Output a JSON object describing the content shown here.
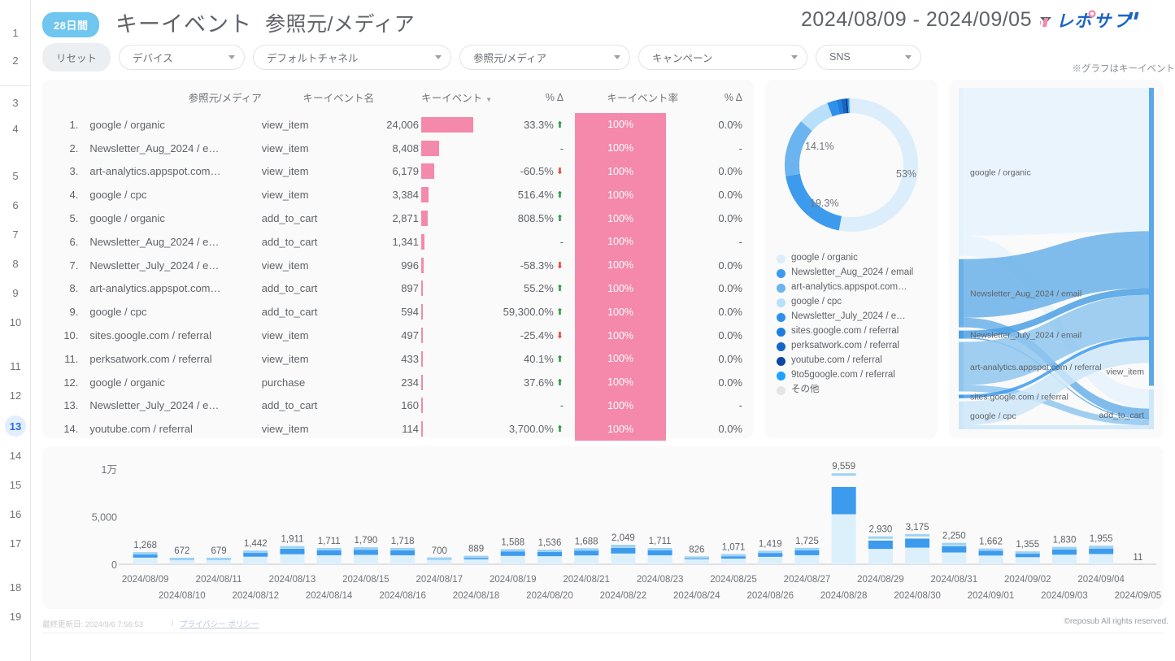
{
  "rail": {
    "pages": [
      "1",
      "2",
      "3",
      "4",
      "5",
      "6",
      "7",
      "8",
      "9",
      "10",
      "11",
      "12",
      "13",
      "14",
      "15",
      "16",
      "17",
      "18",
      "19"
    ],
    "active": "13",
    "next_icon": "chevron-right-icon"
  },
  "header": {
    "badge": "28日間",
    "title": "キーイベント",
    "subtitle": "参照元/メディア",
    "date_range": "2024/08/09 - 2024/09/05",
    "logo_text": "レポサブ",
    "note": "※グラフはキーイベント"
  },
  "filters": {
    "reset_label": "リセット",
    "pills": [
      {
        "label": "デバイス"
      },
      {
        "label": "デフォルトチャネル"
      },
      {
        "label": "参照元/メディア"
      },
      {
        "label": "キャンペーン"
      },
      {
        "label": "SNS"
      }
    ]
  },
  "table": {
    "headers": {
      "index": "",
      "source": "参照元/メディア",
      "event": "キーイベント名",
      "keyevent": "キーイベント",
      "delta1": "% Δ",
      "rate": "キーイベント率",
      "delta2": "% Δ"
    },
    "sort_column": "キーイベント",
    "rows": [
      {
        "index": "1.",
        "source": "google / organic",
        "event": "view_item",
        "value": "24,006",
        "value_num": 24006,
        "delta1": "33.3%",
        "dir1": "up",
        "rate": "100%",
        "delta2": "0.0%",
        "dir2": "none"
      },
      {
        "index": "2.",
        "source": "Newsletter_Aug_2024 / e…",
        "event": "view_item",
        "value": "8,408",
        "value_num": 8408,
        "delta1": "-",
        "dir1": "none",
        "rate": "100%",
        "delta2": "-",
        "dir2": "none"
      },
      {
        "index": "3.",
        "source": "art-analytics.appspot.com…",
        "event": "view_item",
        "value": "6,179",
        "value_num": 6179,
        "delta1": "-60.5%",
        "dir1": "down",
        "rate": "100%",
        "delta2": "0.0%",
        "dir2": "none"
      },
      {
        "index": "4.",
        "source": "google / cpc",
        "event": "view_item",
        "value": "3,384",
        "value_num": 3384,
        "delta1": "516.4%",
        "dir1": "up",
        "rate": "100%",
        "delta2": "0.0%",
        "dir2": "none"
      },
      {
        "index": "5.",
        "source": "google / organic",
        "event": "add_to_cart",
        "value": "2,871",
        "value_num": 2871,
        "delta1": "808.5%",
        "dir1": "up",
        "rate": "100%",
        "delta2": "0.0%",
        "dir2": "none"
      },
      {
        "index": "6.",
        "source": "Newsletter_Aug_2024 / e…",
        "event": "add_to_cart",
        "value": "1,341",
        "value_num": 1341,
        "delta1": "-",
        "dir1": "none",
        "rate": "100%",
        "delta2": "-",
        "dir2": "none"
      },
      {
        "index": "7.",
        "source": "Newsletter_July_2024 / e…",
        "event": "view_item",
        "value": "996",
        "value_num": 996,
        "delta1": "-58.3%",
        "dir1": "down",
        "rate": "100%",
        "delta2": "0.0%",
        "dir2": "none"
      },
      {
        "index": "8.",
        "source": "art-analytics.appspot.com…",
        "event": "add_to_cart",
        "value": "897",
        "value_num": 897,
        "delta1": "55.2%",
        "dir1": "up",
        "rate": "100%",
        "delta2": "0.0%",
        "dir2": "none"
      },
      {
        "index": "9.",
        "source": "google / cpc",
        "event": "add_to_cart",
        "value": "594",
        "value_num": 594,
        "delta1": "59,300.0%",
        "dir1": "up",
        "rate": "100%",
        "delta2": "0.0%",
        "dir2": "none"
      },
      {
        "index": "10.",
        "source": "sites.google.com / referral",
        "event": "view_item",
        "value": "497",
        "value_num": 497,
        "delta1": "-25.4%",
        "dir1": "down",
        "rate": "100%",
        "delta2": "0.0%",
        "dir2": "none"
      },
      {
        "index": "11.",
        "source": "perksatwork.com / referral",
        "event": "view_item",
        "value": "433",
        "value_num": 433,
        "delta1": "40.1%",
        "dir1": "up",
        "rate": "100%",
        "delta2": "0.0%",
        "dir2": "none"
      },
      {
        "index": "12.",
        "source": "google / organic",
        "event": "purchase",
        "value": "234",
        "value_num": 234,
        "delta1": "37.6%",
        "dir1": "up",
        "rate": "100%",
        "delta2": "0.0%",
        "dir2": "none"
      },
      {
        "index": "13.",
        "source": "Newsletter_July_2024 / e…",
        "event": "add_to_cart",
        "value": "160",
        "value_num": 160,
        "delta1": "-",
        "dir1": "none",
        "rate": "100%",
        "delta2": "-",
        "dir2": "none"
      },
      {
        "index": "14.",
        "source": "youtube.com / referral",
        "event": "view_item",
        "value": "114",
        "value_num": 114,
        "delta1": "3,700.0%",
        "dir1": "up",
        "rate": "100%",
        "delta2": "0.0%",
        "dir2": "none"
      }
    ]
  },
  "chart_data": [
    {
      "type": "pie",
      "name": "donut-source-share",
      "title": "",
      "labels_shown": [
        "53%",
        "19.3%",
        "14.1%"
      ],
      "legend_position": "bottom",
      "slices": [
        {
          "label": "google / organic",
          "value": 53.0,
          "color": "#dceefb",
          "shown_label": "53%"
        },
        {
          "label": "Newsletter_Aug_2024 / email",
          "value": 19.3,
          "color": "#3d9bee",
          "shown_label": "19.3%"
        },
        {
          "label": "art-analytics.appspot.com…",
          "value": 14.1,
          "color": "#6bb4f0",
          "shown_label": "14.1%"
        },
        {
          "label": "google / cpc",
          "value": 7.7,
          "color": "#b9e0fa",
          "shown_label": ""
        },
        {
          "label": "Newsletter_July_2024 / e…",
          "value": 2.3,
          "color": "#2f90ea",
          "shown_label": ""
        },
        {
          "label": "sites.google.com / referral",
          "value": 1.1,
          "color": "#1f7fe0",
          "shown_label": ""
        },
        {
          "label": "perksatwork.com / referral",
          "value": 1.0,
          "color": "#1765c4",
          "shown_label": ""
        },
        {
          "label": "youtube.com / referral",
          "value": 0.6,
          "color": "#0d47a1",
          "shown_label": ""
        },
        {
          "label": "9to5google.com / referral",
          "value": 0.4,
          "color": "#1fa2ff",
          "shown_label": ""
        },
        {
          "label": "その他",
          "value": 0.5,
          "color": "#e3e5e7",
          "shown_label": ""
        }
      ]
    },
    {
      "type": "bar",
      "name": "daily-key-events",
      "title": "",
      "xlabel": "",
      "ylabel": "",
      "ylim": [
        0,
        10000
      ],
      "ytick_labels": [
        "0",
        "5,000",
        "1万"
      ],
      "ytick_values": [
        0,
        5000,
        10000
      ],
      "grid": false,
      "categories": [
        "2024/08/09",
        "2024/08/10",
        "2024/08/11",
        "2024/08/12",
        "2024/08/13",
        "2024/08/14",
        "2024/08/15",
        "2024/08/16",
        "2024/08/17",
        "2024/08/18",
        "2024/08/19",
        "2024/08/20",
        "2024/08/21",
        "2024/08/22",
        "2024/08/23",
        "2024/08/24",
        "2024/08/25",
        "2024/08/26",
        "2024/08/27",
        "2024/08/28",
        "2024/08/29",
        "2024/08/30",
        "2024/08/31",
        "2024/09/01",
        "2024/09/02",
        "2024/09/03",
        "2024/09/04",
        "2024/09/05"
      ],
      "values": [
        1268,
        672,
        679,
        1442,
        1911,
        1711,
        1790,
        1718,
        700,
        889,
        1588,
        1536,
        1688,
        2049,
        1711,
        826,
        1071,
        1419,
        1725,
        9559,
        2930,
        3175,
        2250,
        1662,
        1355,
        1830,
        1955,
        11
      ],
      "value_labels": [
        "1,268",
        "672",
        "679",
        "1,442",
        "1,911",
        "1,711",
        "1,790",
        "1,718",
        "700",
        "889",
        "1,588",
        "1,536",
        "1,688",
        "2,049",
        "1,711",
        "826",
        "1,071",
        "1,419",
        "1,725",
        "9,559",
        "2,930",
        "3,175",
        "2,250",
        "1,662",
        "1,355",
        "1,830",
        "1,955",
        "11"
      ]
    },
    {
      "type": "sankey",
      "name": "source-to-event-flow",
      "nodes_left": [
        {
          "label": "google / organic",
          "value": 24006
        },
        {
          "label": "Newsletter_Aug_2024 / email",
          "value": 9749
        },
        {
          "label": "Newsletter_July_2024 / email",
          "value": 1156
        },
        {
          "label": "art-analytics.appspot.com / referral",
          "value": 7076
        },
        {
          "label": "sites.google.com / referral",
          "value": 497
        },
        {
          "label": "google / cpc",
          "value": 3978
        }
      ],
      "nodes_right": [
        {
          "label": "view_item",
          "value": 43424
        },
        {
          "label": "add_to_cart",
          "value": 5863
        }
      ]
    }
  ],
  "footer": {
    "updated": "最終更新日: 2024/9/6 7:56:53",
    "separator": "|",
    "privacy": "プライバシー ポリシー",
    "copyright": "©reposub All rights reserved."
  },
  "colors": {
    "pink": "#f489ab",
    "accent_blue": "#3d9bee",
    "badge_blue": "#6fc6ef",
    "up": "#2e9b45",
    "down": "#e8453c"
  }
}
